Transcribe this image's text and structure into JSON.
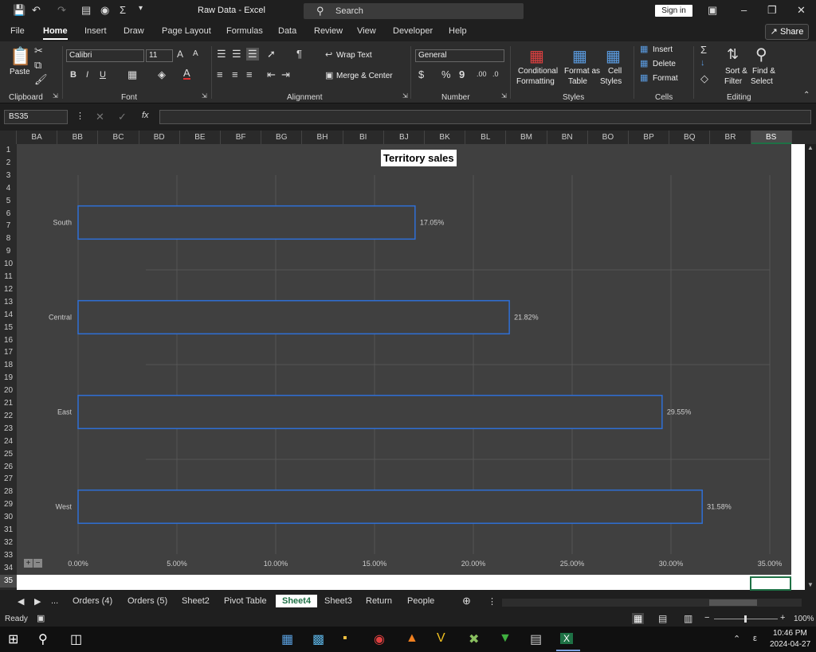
{
  "titlebar": {
    "title": "Raw Data  -  Excel",
    "search_placeholder": "Search",
    "signin": "Sign in"
  },
  "menu": [
    "File",
    "Home",
    "Insert",
    "Draw",
    "Page Layout",
    "Formulas",
    "Data",
    "Review",
    "View",
    "Developer",
    "Help"
  ],
  "share": "Share",
  "ribbon": {
    "paste": "Paste",
    "font_name": "Calibri",
    "font_size": "11",
    "wrap_text": "Wrap Text",
    "merge_center": "Merge & Center",
    "number_format": "General",
    "conditional": [
      "Conditional",
      "Formatting"
    ],
    "format_table": [
      "Format as",
      "Table"
    ],
    "cell_styles": [
      "Cell",
      "Styles"
    ],
    "insert": "Insert",
    "delete": "Delete",
    "format": "Format",
    "sort_filter": [
      "Sort &",
      "Filter"
    ],
    "find_select": [
      "Find &",
      "Select"
    ],
    "groups": [
      "Clipboard",
      "Font",
      "Alignment",
      "Number",
      "Styles",
      "Cells",
      "Editing"
    ]
  },
  "formula_bar": {
    "name_box": "BS35",
    "fx": "fx"
  },
  "columns": [
    "BA",
    "BB",
    "BC",
    "BD",
    "BE",
    "BF",
    "BG",
    "BH",
    "BI",
    "BJ",
    "BK",
    "BL",
    "BM",
    "BN",
    "BO",
    "BP",
    "BQ",
    "BR",
    "BS"
  ],
  "rows": [
    "1",
    "2",
    "3",
    "4",
    "5",
    "6",
    "7",
    "8",
    "9",
    "10",
    "11",
    "12",
    "13",
    "14",
    "15",
    "16",
    "17",
    "18",
    "19",
    "20",
    "21",
    "22",
    "23",
    "24",
    "25",
    "26",
    "27",
    "28",
    "29",
    "30",
    "31",
    "32",
    "33",
    "34",
    "35"
  ],
  "chart_data": {
    "type": "bar",
    "orientation": "horizontal",
    "title": "Territory sales",
    "categories": [
      "South",
      "Central",
      "East",
      "West"
    ],
    "values": [
      17.05,
      21.82,
      29.55,
      31.58
    ],
    "data_labels": [
      "17.05%",
      "21.82%",
      "29.55%",
      "31.58%"
    ],
    "xlim": [
      0,
      35
    ],
    "x_ticks": [
      "0.00%",
      "5.00%",
      "10.00%",
      "15.00%",
      "20.00%",
      "25.00%",
      "30.00%",
      "35.00%"
    ],
    "grid": true,
    "bar_fill": "#404040",
    "bar_border": "#2f6fd6"
  },
  "sheet_tabs": [
    "...",
    "Orders (4)",
    "Orders (5)",
    "Sheet2",
    "Pivot Table",
    "Sheet4",
    "Sheet3",
    "Return",
    "People"
  ],
  "active_tab": "Sheet4",
  "status": {
    "ready": "Ready",
    "zoom": "100%"
  },
  "clock": {
    "time": "10:46 PM",
    "date": "2024-04-27"
  }
}
